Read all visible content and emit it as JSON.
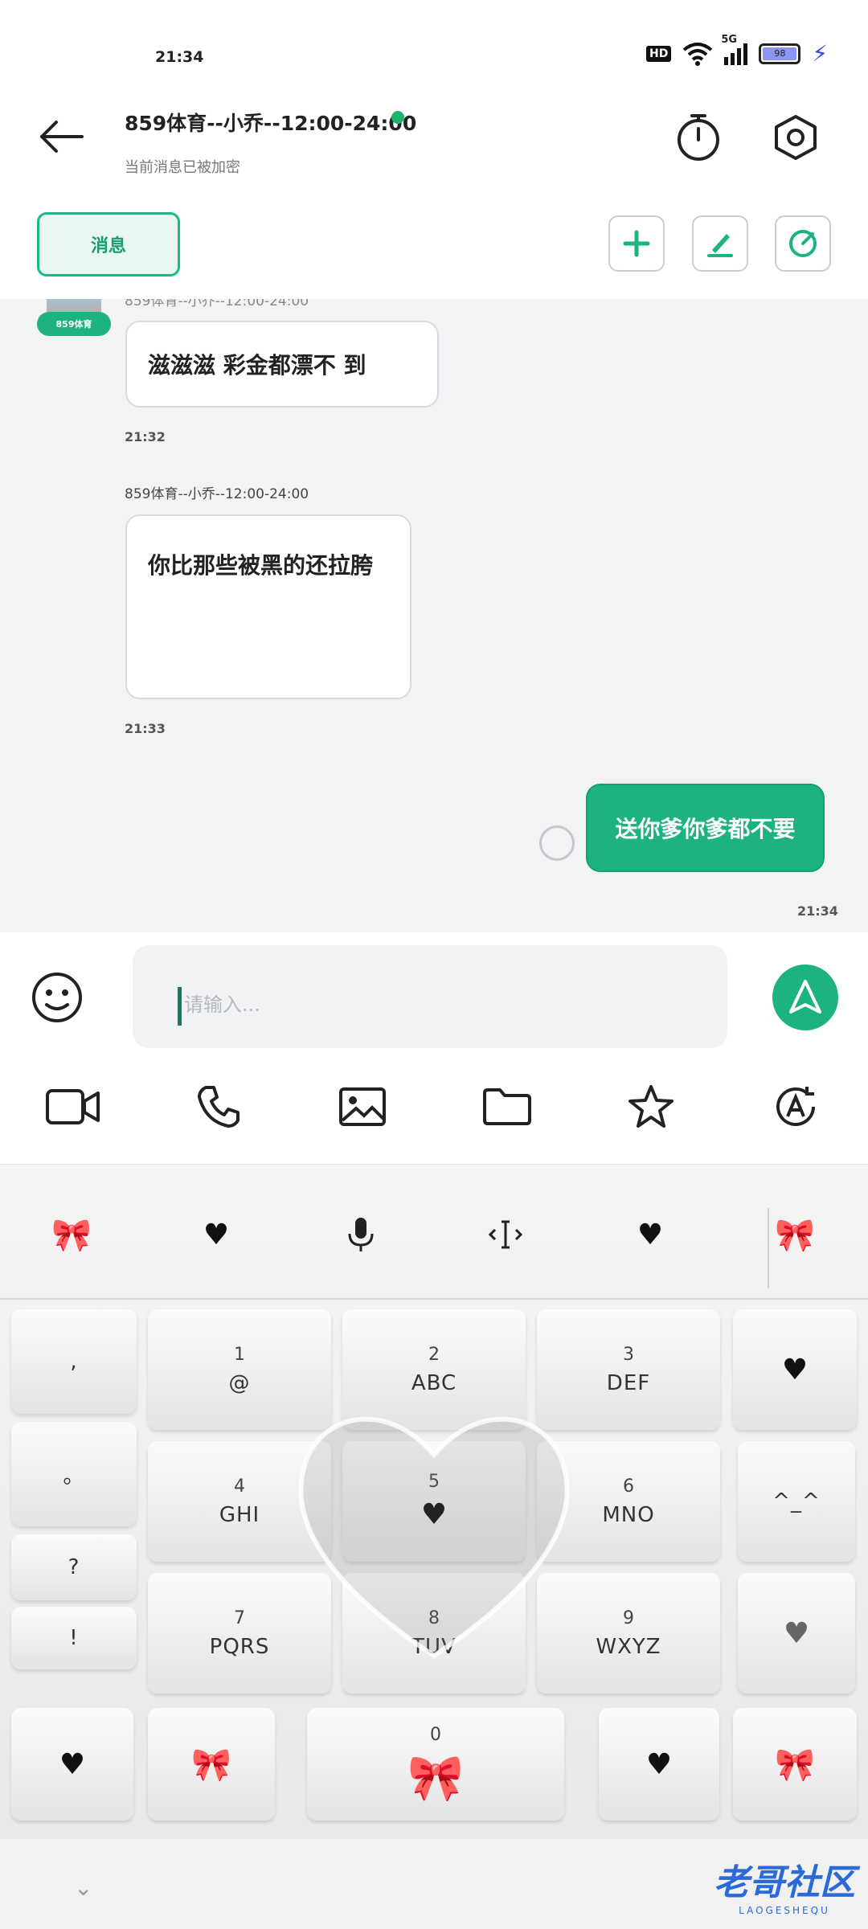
{
  "status": {
    "time": "21:34",
    "hd": "HD",
    "network": "5G",
    "battery": "98"
  },
  "header": {
    "title": "859体育--小乔--12:00-24:00",
    "subtitle": "当前消息已被加密",
    "online_color": "#1db36b"
  },
  "toolbar": {
    "tab_label": "消息"
  },
  "chat": {
    "avatar_badge": "859体育",
    "partial_sender": "859体育--小乔--12:00-24:00",
    "messages": [
      {
        "direction": "in",
        "text": "滋滋滋  彩金都漂不  到",
        "time": "21:32"
      },
      {
        "direction": "in",
        "sender": "859体育--小乔--12:00-24:00",
        "text": "你比那些被黑的还拉胯",
        "time": "21:33"
      },
      {
        "direction": "out",
        "text": "送你爹你爹都不要",
        "time": "21:34"
      }
    ]
  },
  "composer": {
    "placeholder": "请输入..."
  },
  "keyboard": {
    "keys": [
      {
        "num": "1",
        "label": "@"
      },
      {
        "num": "2",
        "label": "ABC"
      },
      {
        "num": "3",
        "label": "DEF"
      },
      {
        "num": "4",
        "label": "GHI"
      },
      {
        "num": "5",
        "label": ""
      },
      {
        "num": "6",
        "label": "MNO"
      },
      {
        "num": "7",
        "label": "PQRS"
      },
      {
        "num": "8",
        "label": "TUV"
      },
      {
        "num": "9",
        "label": "WXYZ"
      },
      {
        "num": "0",
        "label": ""
      }
    ],
    "punct": [
      ",",
      "。",
      "?",
      "!"
    ],
    "face": "^_^"
  },
  "watermark": {
    "text": "老哥社区",
    "sub": "LAOGESHEQU"
  },
  "colors": {
    "accent": "#1db37e",
    "background": "#f2f3f5"
  }
}
